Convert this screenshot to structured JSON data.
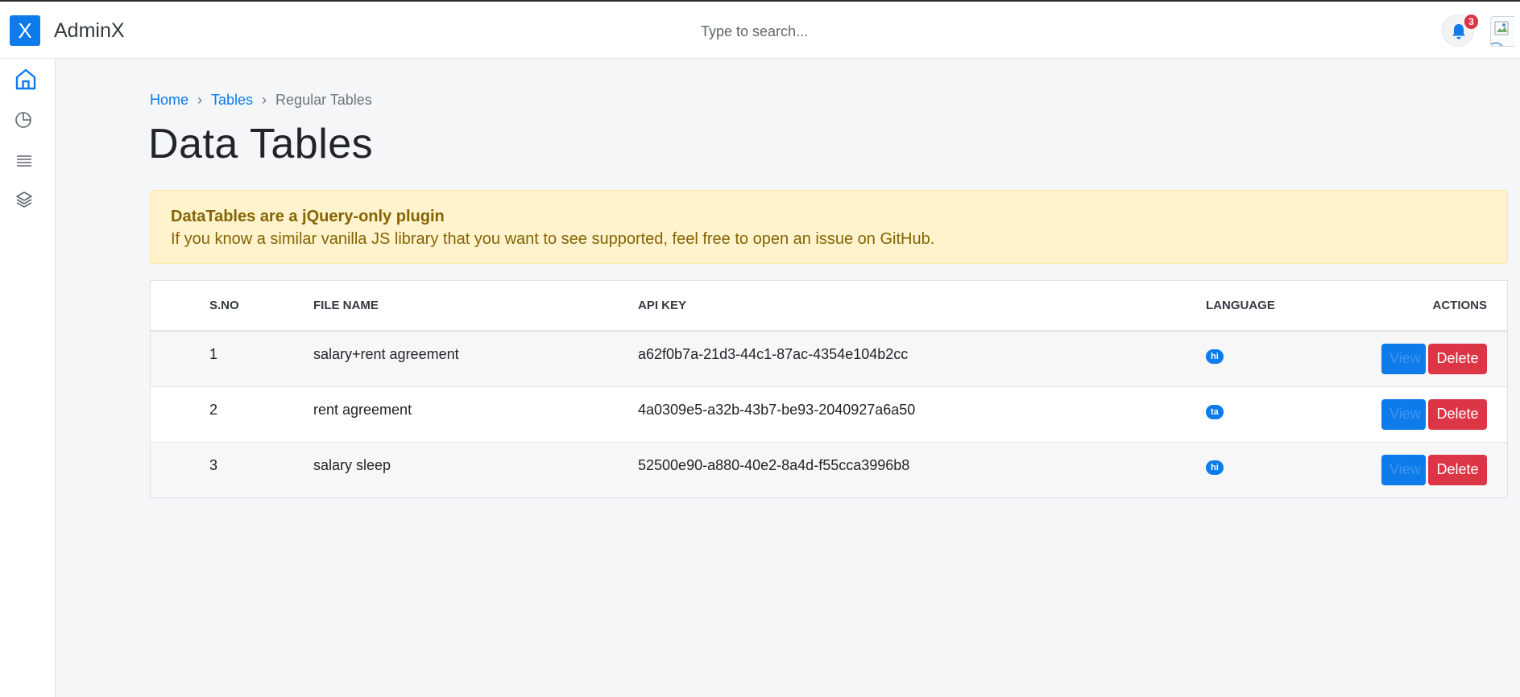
{
  "header": {
    "logo_letter": "X",
    "brand": "AdminX",
    "search_placeholder": "Type to search...",
    "notification_count": "3"
  },
  "sidebar": {
    "items": [
      {
        "name": "home",
        "icon": "home-icon",
        "active": true
      },
      {
        "name": "charts",
        "icon": "pie-chart-icon",
        "active": false
      },
      {
        "name": "tables",
        "icon": "list-icon",
        "active": false
      },
      {
        "name": "layers",
        "icon": "layers-icon",
        "active": false
      }
    ]
  },
  "breadcrumb": {
    "items": [
      "Home",
      "Tables",
      "Regular Tables"
    ],
    "separator": "›"
  },
  "page_title": "Data Tables",
  "alert": {
    "title": "DataTables are a jQuery-only plugin",
    "body": "If you know a similar vanilla JS library that you want to see supported, feel free to open an issue on GitHub."
  },
  "table": {
    "headers": [
      "S.NO",
      "FILE NAME",
      "API KEY",
      "LANGUAGE",
      "ACTIONS"
    ],
    "rows": [
      {
        "sno": "1",
        "file": "salary+rent agreement",
        "api": "a62f0b7a-21d3-44c1-87ac-4354e104b2cc",
        "lang": "hi"
      },
      {
        "sno": "2",
        "file": "rent agreement",
        "api": "4a0309e5-a32b-43b7-be93-2040927a6a50",
        "lang": "ta"
      },
      {
        "sno": "3",
        "file": "salary sleep",
        "api": "52500e90-a880-40e2-8a4d-f55cca3996b8",
        "lang": "hi"
      }
    ],
    "view_label": "View",
    "delete_label": "Delete"
  },
  "colors": {
    "primary": "#0d7bea",
    "danger": "#dc3545",
    "alert_bg": "#fff3cd",
    "alert_text": "#856404"
  }
}
